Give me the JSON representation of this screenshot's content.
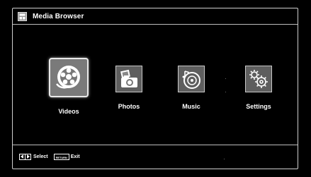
{
  "header": {
    "title": "Media Browser",
    "icon": "media-browser-icon"
  },
  "menu": {
    "selected_index": 0,
    "items": [
      {
        "label": "Videos",
        "icon": "film-reel-icon"
      },
      {
        "label": "Photos",
        "icon": "camera-photo-icon"
      },
      {
        "label": "Music",
        "icon": "music-disc-icon"
      },
      {
        "label": "Settings",
        "icon": "gears-icon"
      }
    ]
  },
  "footer": {
    "nav_keys_icon": "left-right-keys-icon",
    "select_label": "Select",
    "return_key_label": "RETURN",
    "exit_label": "Exit"
  },
  "colors": {
    "background": "#000000",
    "frame": "#cfcfcf",
    "tile_fill": "#5e5e5e",
    "tile_selected_fill": "#7a7a7a",
    "text": "#ffffff"
  }
}
